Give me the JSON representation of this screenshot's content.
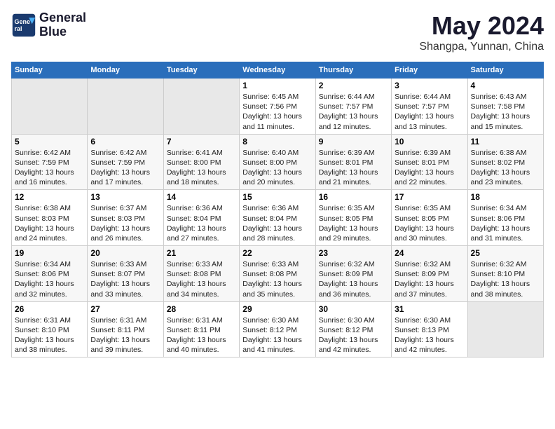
{
  "header": {
    "logo_line1": "General",
    "logo_line2": "Blue",
    "month": "May 2024",
    "location": "Shangpa, Yunnan, China"
  },
  "weekdays": [
    "Sunday",
    "Monday",
    "Tuesday",
    "Wednesday",
    "Thursday",
    "Friday",
    "Saturday"
  ],
  "weeks": [
    [
      {
        "day": "",
        "info": ""
      },
      {
        "day": "",
        "info": ""
      },
      {
        "day": "",
        "info": ""
      },
      {
        "day": "1",
        "info": "Sunrise: 6:45 AM\nSunset: 7:56 PM\nDaylight: 13 hours\nand 11 minutes."
      },
      {
        "day": "2",
        "info": "Sunrise: 6:44 AM\nSunset: 7:57 PM\nDaylight: 13 hours\nand 12 minutes."
      },
      {
        "day": "3",
        "info": "Sunrise: 6:44 AM\nSunset: 7:57 PM\nDaylight: 13 hours\nand 13 minutes."
      },
      {
        "day": "4",
        "info": "Sunrise: 6:43 AM\nSunset: 7:58 PM\nDaylight: 13 hours\nand 15 minutes."
      }
    ],
    [
      {
        "day": "5",
        "info": "Sunrise: 6:42 AM\nSunset: 7:59 PM\nDaylight: 13 hours\nand 16 minutes."
      },
      {
        "day": "6",
        "info": "Sunrise: 6:42 AM\nSunset: 7:59 PM\nDaylight: 13 hours\nand 17 minutes."
      },
      {
        "day": "7",
        "info": "Sunrise: 6:41 AM\nSunset: 8:00 PM\nDaylight: 13 hours\nand 18 minutes."
      },
      {
        "day": "8",
        "info": "Sunrise: 6:40 AM\nSunset: 8:00 PM\nDaylight: 13 hours\nand 20 minutes."
      },
      {
        "day": "9",
        "info": "Sunrise: 6:39 AM\nSunset: 8:01 PM\nDaylight: 13 hours\nand 21 minutes."
      },
      {
        "day": "10",
        "info": "Sunrise: 6:39 AM\nSunset: 8:01 PM\nDaylight: 13 hours\nand 22 minutes."
      },
      {
        "day": "11",
        "info": "Sunrise: 6:38 AM\nSunset: 8:02 PM\nDaylight: 13 hours\nand 23 minutes."
      }
    ],
    [
      {
        "day": "12",
        "info": "Sunrise: 6:38 AM\nSunset: 8:03 PM\nDaylight: 13 hours\nand 24 minutes."
      },
      {
        "day": "13",
        "info": "Sunrise: 6:37 AM\nSunset: 8:03 PM\nDaylight: 13 hours\nand 26 minutes."
      },
      {
        "day": "14",
        "info": "Sunrise: 6:36 AM\nSunset: 8:04 PM\nDaylight: 13 hours\nand 27 minutes."
      },
      {
        "day": "15",
        "info": "Sunrise: 6:36 AM\nSunset: 8:04 PM\nDaylight: 13 hours\nand 28 minutes."
      },
      {
        "day": "16",
        "info": "Sunrise: 6:35 AM\nSunset: 8:05 PM\nDaylight: 13 hours\nand 29 minutes."
      },
      {
        "day": "17",
        "info": "Sunrise: 6:35 AM\nSunset: 8:05 PM\nDaylight: 13 hours\nand 30 minutes."
      },
      {
        "day": "18",
        "info": "Sunrise: 6:34 AM\nSunset: 8:06 PM\nDaylight: 13 hours\nand 31 minutes."
      }
    ],
    [
      {
        "day": "19",
        "info": "Sunrise: 6:34 AM\nSunset: 8:06 PM\nDaylight: 13 hours\nand 32 minutes."
      },
      {
        "day": "20",
        "info": "Sunrise: 6:33 AM\nSunset: 8:07 PM\nDaylight: 13 hours\nand 33 minutes."
      },
      {
        "day": "21",
        "info": "Sunrise: 6:33 AM\nSunset: 8:08 PM\nDaylight: 13 hours\nand 34 minutes."
      },
      {
        "day": "22",
        "info": "Sunrise: 6:33 AM\nSunset: 8:08 PM\nDaylight: 13 hours\nand 35 minutes."
      },
      {
        "day": "23",
        "info": "Sunrise: 6:32 AM\nSunset: 8:09 PM\nDaylight: 13 hours\nand 36 minutes."
      },
      {
        "day": "24",
        "info": "Sunrise: 6:32 AM\nSunset: 8:09 PM\nDaylight: 13 hours\nand 37 minutes."
      },
      {
        "day": "25",
        "info": "Sunrise: 6:32 AM\nSunset: 8:10 PM\nDaylight: 13 hours\nand 38 minutes."
      }
    ],
    [
      {
        "day": "26",
        "info": "Sunrise: 6:31 AM\nSunset: 8:10 PM\nDaylight: 13 hours\nand 38 minutes."
      },
      {
        "day": "27",
        "info": "Sunrise: 6:31 AM\nSunset: 8:11 PM\nDaylight: 13 hours\nand 39 minutes."
      },
      {
        "day": "28",
        "info": "Sunrise: 6:31 AM\nSunset: 8:11 PM\nDaylight: 13 hours\nand 40 minutes."
      },
      {
        "day": "29",
        "info": "Sunrise: 6:30 AM\nSunset: 8:12 PM\nDaylight: 13 hours\nand 41 minutes."
      },
      {
        "day": "30",
        "info": "Sunrise: 6:30 AM\nSunset: 8:12 PM\nDaylight: 13 hours\nand 42 minutes."
      },
      {
        "day": "31",
        "info": "Sunrise: 6:30 AM\nSunset: 8:13 PM\nDaylight: 13 hours\nand 42 minutes."
      },
      {
        "day": "",
        "info": ""
      }
    ]
  ]
}
